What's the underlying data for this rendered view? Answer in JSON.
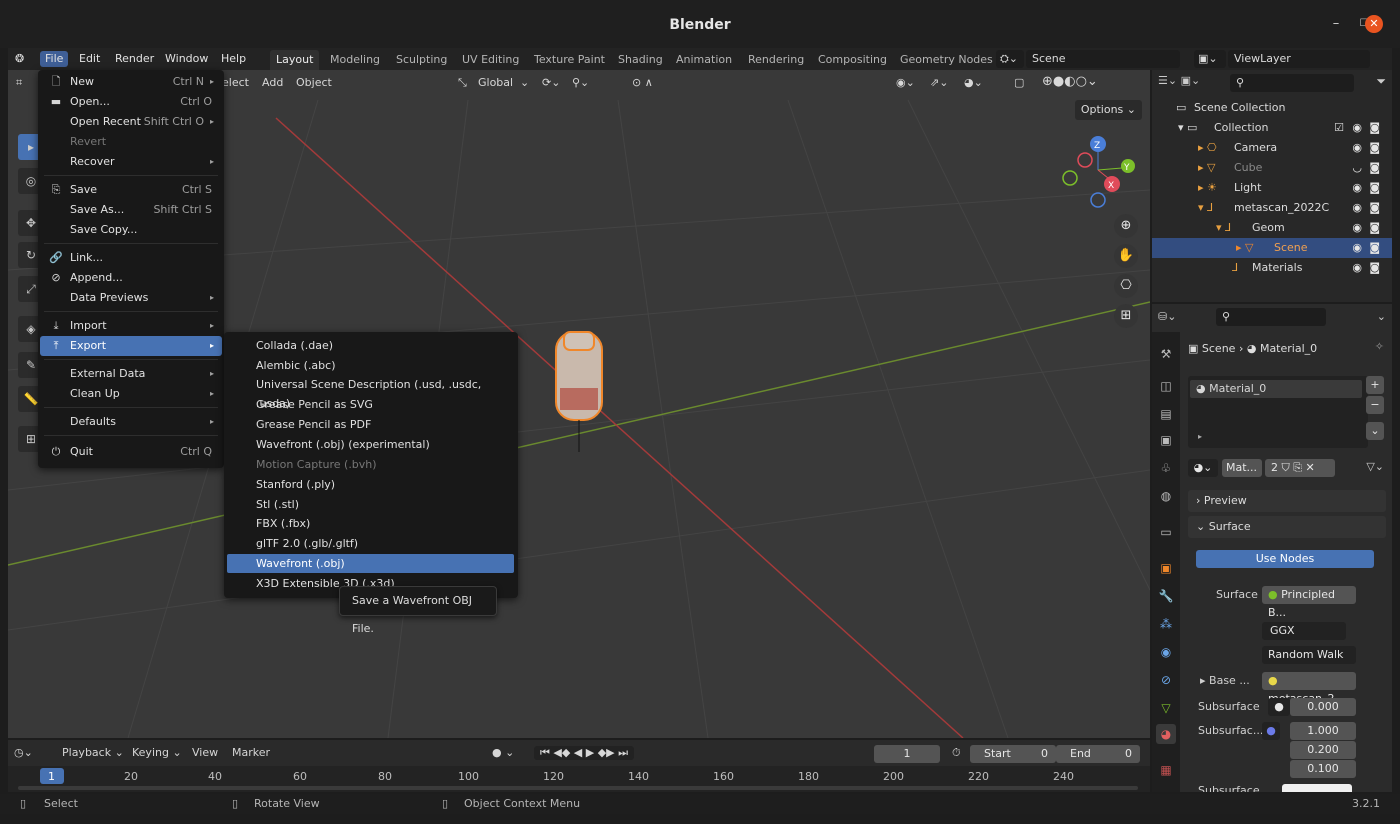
{
  "window": {
    "title": "Blender"
  },
  "topbar": {
    "menus": [
      "File",
      "Edit",
      "Render",
      "Window",
      "Help"
    ],
    "workspaces": [
      "Layout",
      "Modeling",
      "Sculpting",
      "UV Editing",
      "Texture Paint",
      "Shading",
      "Animation",
      "Rendering",
      "Compositing",
      "Geometry Nodes"
    ],
    "scene_name": "Scene",
    "view_layer": "ViewLayer"
  },
  "viewport": {
    "header": {
      "select": "elect",
      "add": "Add",
      "object": "Object",
      "transform": "Global"
    },
    "options": "Options"
  },
  "file_menu": {
    "items": [
      {
        "label": "New",
        "shortcut": "Ctrl N",
        "icon": "new-file-icon"
      },
      {
        "label": "Open...",
        "shortcut": "Ctrl O",
        "icon": "folder-icon"
      },
      {
        "label": "Open Recent",
        "shortcut": "Shift Ctrl O"
      },
      {
        "label": "Revert",
        "shortcut": ""
      },
      {
        "label": "Recover",
        "shortcut": ""
      },
      {
        "label": "Save",
        "shortcut": "Ctrl S",
        "icon": "save-icon"
      },
      {
        "label": "Save As...",
        "shortcut": "Shift Ctrl S"
      },
      {
        "label": "Save Copy...",
        "shortcut": ""
      },
      {
        "label": "Link...",
        "shortcut": "",
        "icon": "link-icon"
      },
      {
        "label": "Append...",
        "shortcut": "",
        "icon": "append-icon"
      },
      {
        "label": "Data Previews",
        "shortcut": ""
      },
      {
        "label": "Import",
        "shortcut": "",
        "icon": "import-icon"
      },
      {
        "label": "Export",
        "shortcut": "",
        "icon": "export-icon"
      },
      {
        "label": "External Data",
        "shortcut": ""
      },
      {
        "label": "Clean Up",
        "shortcut": ""
      },
      {
        "label": "Defaults",
        "shortcut": ""
      },
      {
        "label": "Quit",
        "shortcut": "Ctrl Q",
        "icon": "power-icon"
      }
    ]
  },
  "export_menu": {
    "items": [
      "Collada (.dae)",
      "Alembic (.abc)",
      "Universal Scene Description (.usd, .usdc, .usda)",
      "Grease Pencil as SVG",
      "Grease Pencil as PDF",
      "Wavefront (.obj) (experimental)",
      "Motion Capture (.bvh)",
      "Stanford (.ply)",
      "Stl (.stl)",
      "FBX (.fbx)",
      "glTF 2.0 (.glb/.gltf)",
      "Wavefront (.obj)",
      "X3D Extensible 3D (.x3d)"
    ],
    "tooltip": "Save a Wavefront OBJ File."
  },
  "outliner": {
    "rows": [
      "Scene Collection",
      "Collection",
      "Camera",
      "Cube",
      "Light",
      "metascan_2022C",
      "Geom",
      "Scene",
      "Materials"
    ]
  },
  "properties": {
    "breadcrumb_scene": "Scene",
    "breadcrumb_material": "Material_0",
    "material_slot": "Material_0",
    "material_short": "Mat...",
    "users": "2",
    "preview_label": "Preview",
    "surface_label": "Surface",
    "use_nodes": "Use Nodes",
    "surface_field_label": "Surface",
    "surface_shader": "Principled B...",
    "distribution": "GGX",
    "subsurface_method": "Random Walk",
    "base_label": "Base ...",
    "base_value": "metascan_2...",
    "subsurface_label": "Subsurface",
    "subsurface_value": "0.000",
    "subsurface_radius_label": "Subsurfac...",
    "radius_values": [
      "1.000",
      "0.200",
      "0.100"
    ],
    "subsurface_color_label": "Subsurface"
  },
  "timeline": {
    "playback": "Playback",
    "keying": "Keying",
    "view": "View",
    "marker": "Marker",
    "current_frame": "1",
    "start_label": "Start",
    "start_value": "0",
    "end_label": "End",
    "end_value": "0",
    "ruler": [
      "1",
      "20",
      "40",
      "60",
      "80",
      "100",
      "120",
      "140",
      "160",
      "180",
      "200",
      "220",
      "240"
    ]
  },
  "statusbar": {
    "select": "Select",
    "rotate": "Rotate View",
    "context": "Object Context Menu",
    "version": "3.2.1"
  }
}
